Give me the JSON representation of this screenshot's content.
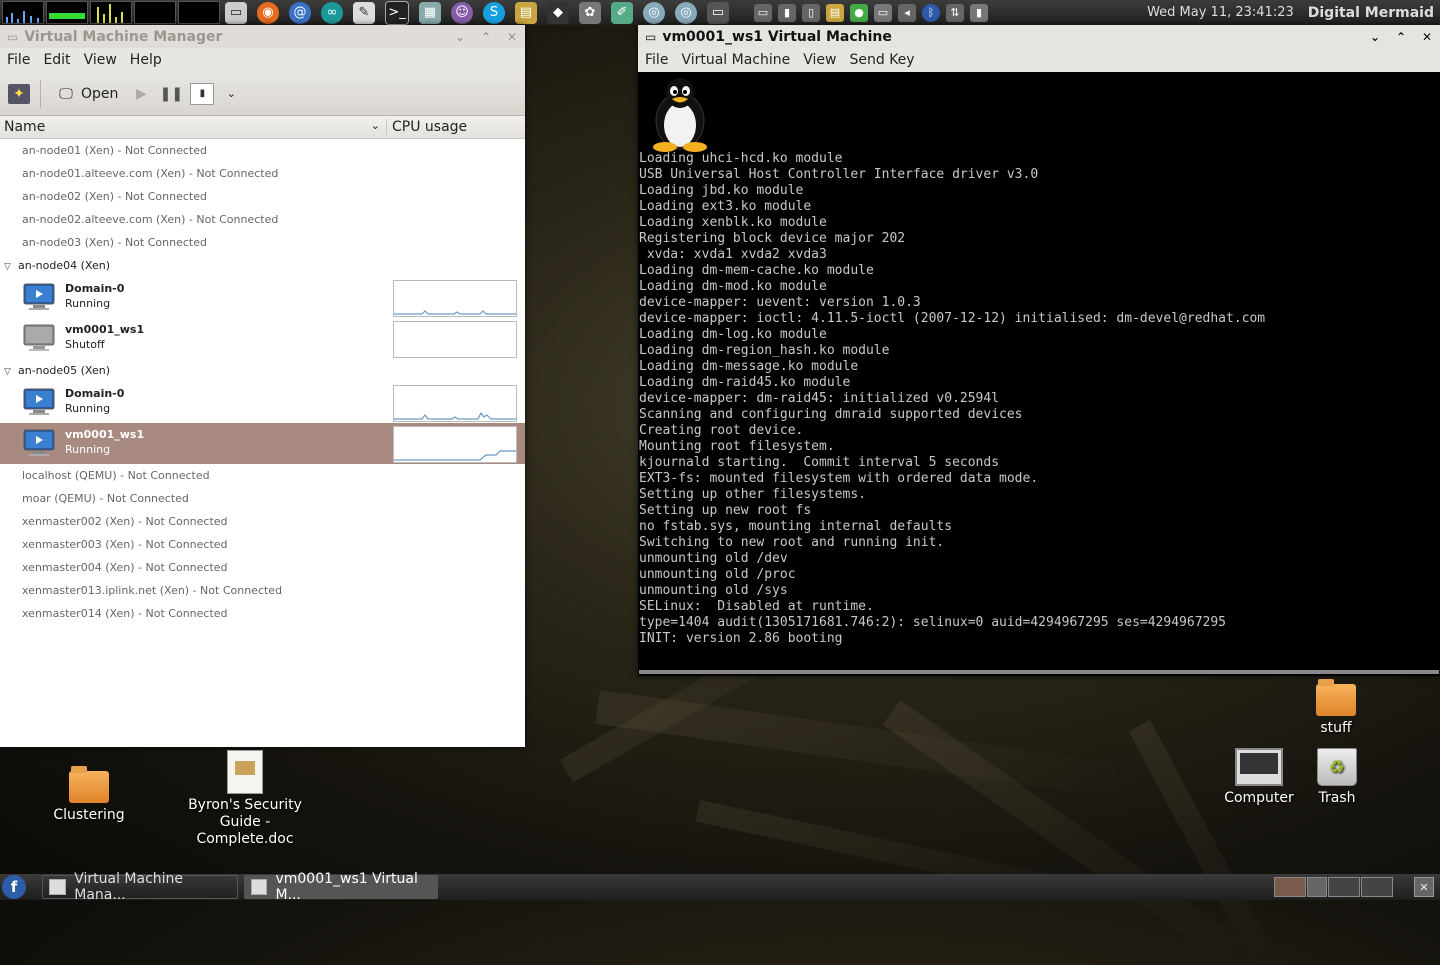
{
  "top_panel": {
    "clock": "Wed May 11, 23:41:23",
    "user": "Digital Mermaid"
  },
  "vmm": {
    "title": "Virtual Machine Manager",
    "menu": [
      "File",
      "Edit",
      "View",
      "Help"
    ],
    "toolbar": {
      "open_label": "Open"
    },
    "columns": {
      "name": "Name",
      "cpu": "CPU usage"
    },
    "conn_top": [
      "an-node01 (Xen) - Not Connected",
      "an-node01.alteeve.com (Xen) - Not Connected",
      "an-node02 (Xen) - Not Connected",
      "an-node02.alteeve.com (Xen) - Not Connected",
      "an-node03 (Xen) - Not Connected"
    ],
    "host4": {
      "name": "an-node04 (Xen)",
      "vms": [
        {
          "name": "Domain-0",
          "state": "Running"
        },
        {
          "name": "vm0001_ws1",
          "state": "Shutoff"
        }
      ]
    },
    "host5": {
      "name": "an-node05 (Xen)",
      "vms": [
        {
          "name": "Domain-0",
          "state": "Running"
        },
        {
          "name": "vm0001_ws1",
          "state": "Running"
        }
      ]
    },
    "conn_bottom": [
      "localhost (QEMU) - Not Connected",
      "moar (QEMU) - Not Connected",
      "xenmaster002 (Xen) - Not Connected",
      "xenmaster003 (Xen) - Not Connected",
      "xenmaster004 (Xen) - Not Connected",
      "xenmaster013.iplink.net (Xen) - Not Connected",
      "xenmaster014 (Xen) - Not Connected"
    ]
  },
  "console_win": {
    "title": "vm0001_ws1 Virtual Machine",
    "menu": [
      "File",
      "Virtual Machine",
      "View",
      "Send Key"
    ],
    "lines": [
      "Loading uhci-hcd.ko module",
      "USB Universal Host Controller Interface driver v3.0",
      "Loading jbd.ko module",
      "Loading ext3.ko module",
      "Loading xenblk.ko module",
      "Registering block device major 202",
      " xvda: xvda1 xvda2 xvda3",
      "Loading dm-mem-cache.ko module",
      "Loading dm-mod.ko module",
      "device-mapper: uevent: version 1.0.3",
      "device-mapper: ioctl: 4.11.5-ioctl (2007-12-12) initialised: dm-devel@redhat.com",
      "Loading dm-log.ko module",
      "Loading dm-region_hash.ko module",
      "Loading dm-message.ko module",
      "Loading dm-raid45.ko module",
      "device-mapper: dm-raid45: initialized v0.2594l",
      "Scanning and configuring dmraid supported devices",
      "Creating root device.",
      "Mounting root filesystem.",
      "kjournald starting.  Commit interval 5 seconds",
      "EXT3-fs: mounted filesystem with ordered data mode.",
      "Setting up other filesystems.",
      "Setting up new root fs",
      "no fstab.sys, mounting internal defaults",
      "Switching to new root and running init.",
      "unmounting old /dev",
      "unmounting old /proc",
      "unmounting old /sys",
      "SELinux:  Disabled at runtime.",
      "type=1404 audit(1305171681.746:2): selinux=0 auid=4294967295 ses=4294967295",
      "INIT: version 2.86 booting",
      "",
      "_"
    ]
  },
  "desktop": {
    "clustering": "Clustering",
    "doc": "Byron's Security Guide - Complete.doc",
    "stuff": "stuff",
    "computer": "Computer",
    "trash": "Trash"
  },
  "taskbar": {
    "task1": "Virtual Machine Mana...",
    "task2": "vm0001_ws1 Virtual M..."
  }
}
